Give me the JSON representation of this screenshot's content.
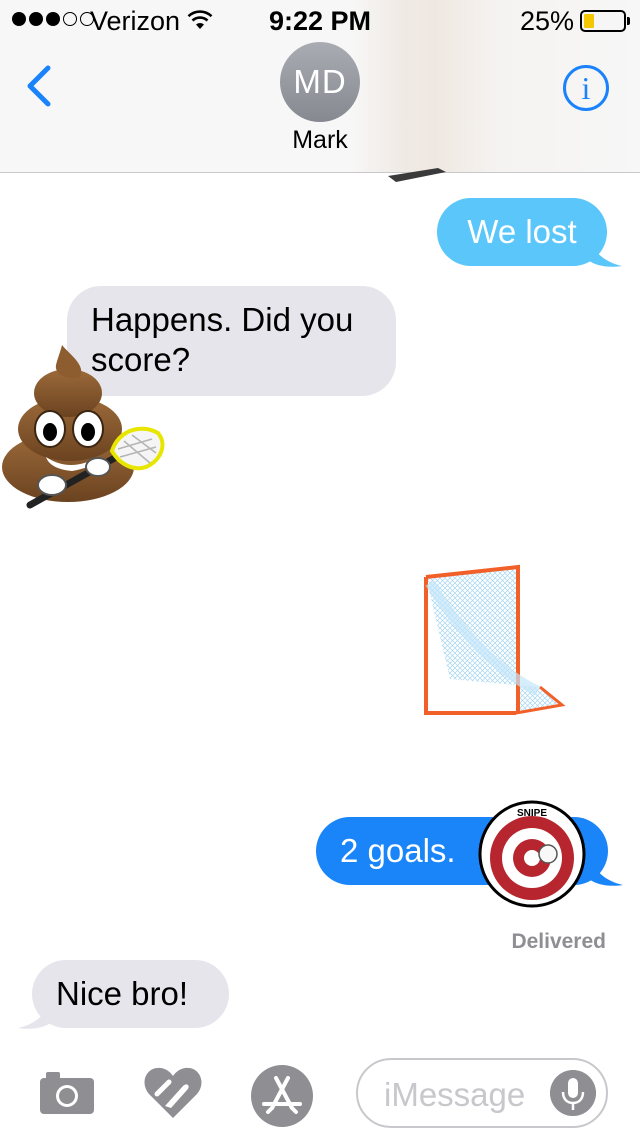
{
  "status_bar": {
    "carrier": "Verizon",
    "time": "9:22 PM",
    "battery_percent": "25%",
    "battery_level": 0.25,
    "signal_bars_filled": 3,
    "signal_bars_total": 5
  },
  "header": {
    "avatar_initials": "MD",
    "contact_name": "Mark",
    "info_glyph": "i"
  },
  "messages": [
    {
      "direction": "sent",
      "text": "We lost"
    },
    {
      "direction": "received",
      "text": "Happens. Did you score?"
    },
    {
      "direction": "sent",
      "text": "2 goals."
    },
    {
      "direction": "received",
      "text": "Nice bro!"
    }
  ],
  "stickers": [
    {
      "name": "poo-lacrosse-sticker"
    },
    {
      "name": "lacrosse-goal-sticker"
    },
    {
      "name": "snipe-target-sticker",
      "text": "SNIPE"
    }
  ],
  "delivery_status": "Delivered",
  "input": {
    "placeholder": "iMessage"
  },
  "icons": [
    "back-chevron-icon",
    "info-icon",
    "camera-icon",
    "digital-touch-icon",
    "app-store-icon",
    "microphone-icon",
    "wifi-icon"
  ],
  "colors": {
    "sent_bubble": "#1a84f9",
    "sent_bubble_light": "#5ac6fa",
    "received_bubble": "#e6e5eb",
    "accent": "#1a82fb",
    "battery_fill": "#f5c700"
  }
}
